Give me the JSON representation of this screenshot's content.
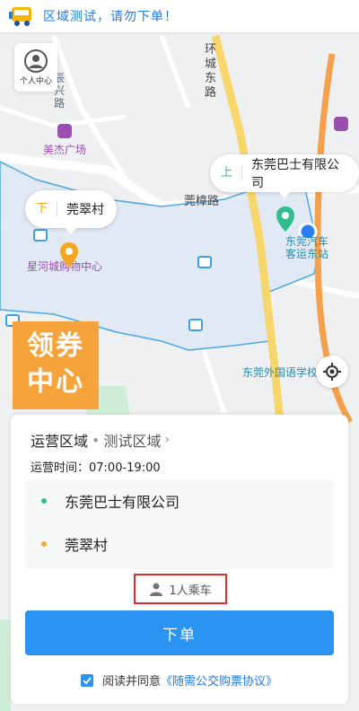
{
  "notice": {
    "text": "区域测试，请勿下单！",
    "icon": "bus-icon"
  },
  "personal_center": {
    "label": "个人中心",
    "icon": "user-avatar-icon"
  },
  "map": {
    "roads": [
      "环城东路",
      "莞樟路"
    ],
    "places": [
      "美杰广场",
      "星河城购物中心",
      "东莞汽车客运东站",
      "东莞外国语学校",
      "辰兴路"
    ],
    "colors": {
      "area_fill": "#dfe9f5",
      "area_border": "#3aa0e6",
      "main_road": "#f7d66b",
      "orange_road": "#f5a04a"
    }
  },
  "bubbles": {
    "up": {
      "tag": "上",
      "name": "东莞巴士有限公司"
    },
    "down": {
      "tag": "下",
      "name": "莞翠村"
    }
  },
  "coupon": {
    "line1": "领券",
    "line2": "中心",
    "color": "#f5a33a"
  },
  "panel": {
    "area_title": "运营区域",
    "separator": "•",
    "area_name": "测试区域",
    "chevron": "›",
    "hours": "运营时间：07:00-19:00",
    "stops": [
      {
        "name": "东莞巴士有限公司",
        "color": "#2fbf8f"
      },
      {
        "name": "莞翠村",
        "color": "#f5a623"
      }
    ],
    "riders": "1人乘车",
    "order_button": "下单",
    "agree_text": "阅读并同意",
    "agree_link": "《随需公交购票协议》"
  }
}
